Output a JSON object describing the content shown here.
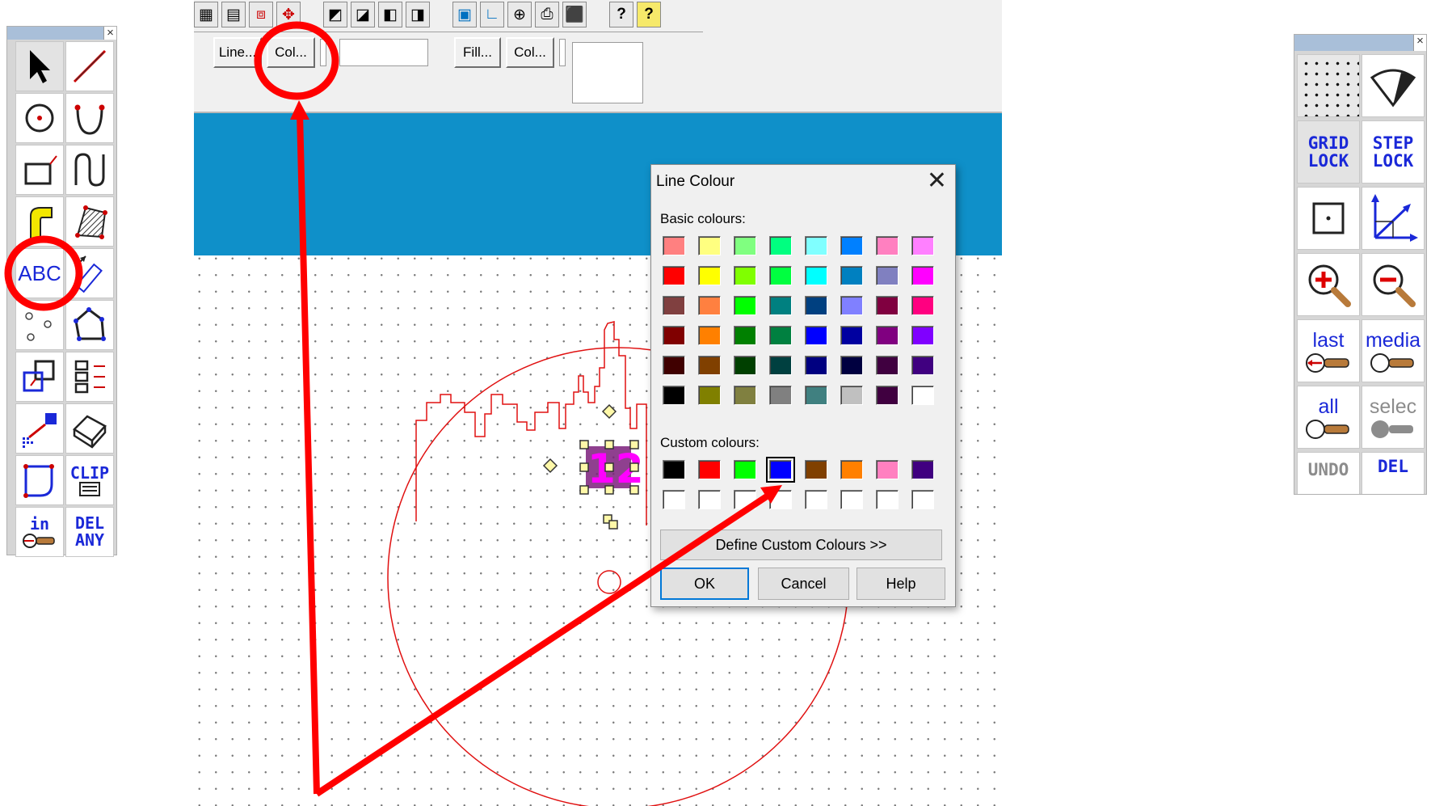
{
  "left_palette": {
    "close_glyph": "×",
    "tools": [
      {
        "name": "pointer-tool",
        "icon": "arrow-pointer-icon"
      },
      {
        "name": "line-tool",
        "icon": "line-icon"
      },
      {
        "name": "circle-tool",
        "icon": "circle-icon"
      },
      {
        "name": "arc-tool",
        "icon": "arc-icon"
      },
      {
        "name": "rectangle-tool",
        "icon": "rectangle-icon"
      },
      {
        "name": "curve-tool",
        "icon": "curve-icon"
      },
      {
        "name": "path-tool",
        "icon": "path-icon"
      },
      {
        "name": "hatch-tool",
        "icon": "hatch-icon"
      },
      {
        "name": "text-tool",
        "label": "ABC"
      },
      {
        "name": "dimension-tool",
        "icon": "dimension-icon"
      },
      {
        "name": "points-tool",
        "icon": "points-icon"
      },
      {
        "name": "polygon-tool",
        "icon": "polygon-icon"
      },
      {
        "name": "group-tool",
        "icon": "group-icon"
      },
      {
        "name": "align-tool",
        "icon": "align-icon"
      },
      {
        "name": "color-fill-tool",
        "icon": "color-fill-icon"
      },
      {
        "name": "3d-box-tool",
        "icon": "3d-box-icon"
      },
      {
        "name": "rounded-rect-tool",
        "icon": "rounded-rect-icon"
      },
      {
        "name": "clip-tool",
        "label": "CLIP"
      },
      {
        "name": "zoom-in-tool",
        "label": "in"
      },
      {
        "name": "delete-any-tool",
        "label_top": "DEL",
        "label_bottom": "ANY"
      }
    ]
  },
  "toolbar": {
    "line_button": "Line...",
    "line_col_button": "Col...",
    "fill_button": "Fill...",
    "fill_col_button": "Col...",
    "help_icon": "?",
    "context_help_icon": "?"
  },
  "dialog": {
    "title": "Line Colour",
    "close_glyph": "✕",
    "basic_label": "Basic colours:",
    "custom_label": "Custom colours:",
    "define_button": "Define Custom Colours >>",
    "ok_button": "OK",
    "cancel_button": "Cancel",
    "help_button": "Help",
    "basic_colours": [
      [
        "#ff8080",
        "#ffff80",
        "#80ff80",
        "#00ff80",
        "#80ffff",
        "#0080ff",
        "#ff80c0",
        "#ff80ff"
      ],
      [
        "#ff0000",
        "#ffff00",
        "#80ff00",
        "#00ff40",
        "#00ffff",
        "#0080c0",
        "#8080c0",
        "#ff00ff"
      ],
      [
        "#804040",
        "#ff8040",
        "#00ff00",
        "#008080",
        "#004080",
        "#8080ff",
        "#800040",
        "#ff0080"
      ],
      [
        "#800000",
        "#ff8000",
        "#008000",
        "#008040",
        "#0000ff",
        "#0000a0",
        "#800080",
        "#8000ff"
      ],
      [
        "#400000",
        "#804000",
        "#004000",
        "#004040",
        "#000080",
        "#000040",
        "#400040",
        "#400080"
      ],
      [
        "#000000",
        "#808000",
        "#808040",
        "#808080",
        "#408080",
        "#c0c0c0",
        "#400040",
        "#ffffff"
      ]
    ],
    "custom_colours": [
      [
        "#000000",
        "#ff0000",
        "#00ff00",
        "#0000ff",
        "#804000",
        "#ff8000",
        "#ff80c0",
        "#400080"
      ],
      [
        "#ffffff",
        "#ffffff",
        "#ffffff",
        "#ffffff",
        "#ffffff",
        "#ffffff",
        "#ffffff",
        "#ffffff"
      ]
    ],
    "selected_custom": "#0000ff"
  },
  "right_palette": {
    "close_glyph": "×",
    "grid_lock": [
      "GRID",
      "LOCK"
    ],
    "step_lock": [
      "STEP",
      "LOCK"
    ],
    "last_label": "last",
    "media_label": "media",
    "all_label": "all",
    "select_label": "selec",
    "undo_label": "UNDO",
    "del_label": "DEL"
  },
  "drawing": {
    "text_object": "12"
  },
  "annotation_color": "#ff0000"
}
